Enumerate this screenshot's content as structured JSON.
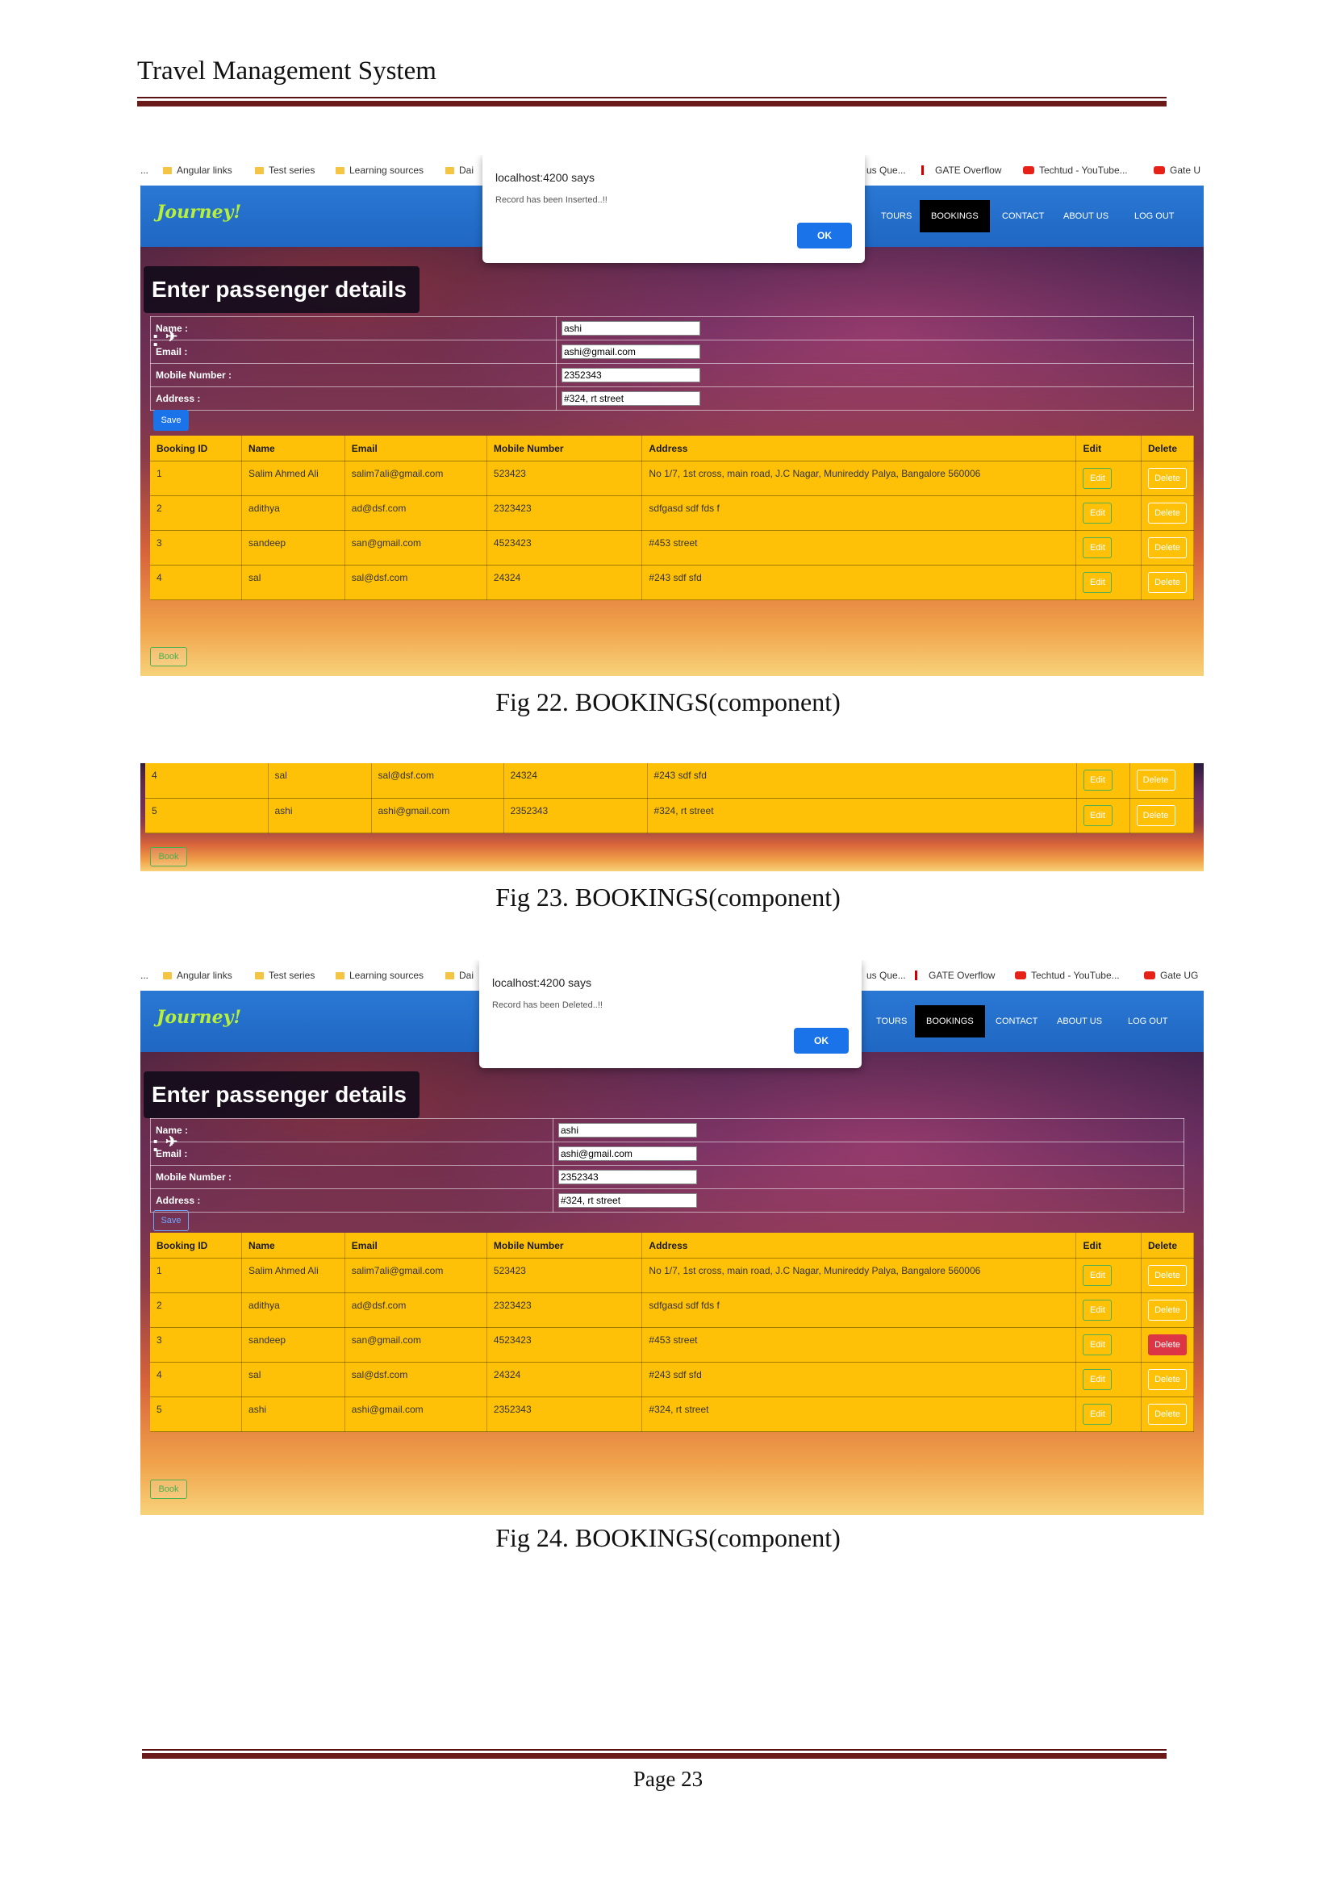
{
  "document": {
    "header_title": "Travel Management System",
    "page_label": "Page 23"
  },
  "bookmarks": {
    "ellipsis": "...",
    "angular": "Angular links",
    "test_series": "Test series",
    "learning": "Learning sources",
    "dai": "Dai",
    "us_que": "us Que...",
    "gate_overflow": "GATE Overflow",
    "techtud": "Techtud - YouTube...",
    "gate_u": "Gate U",
    "gate_ug": "Gate UG"
  },
  "app": {
    "logo": "Journey!",
    "nav": [
      "TOURS",
      "BOOKINGS",
      "CONTACT",
      "ABOUT US",
      "LOG OUT"
    ],
    "heading": "Enter passenger details :",
    "heading_icon": "takeoff-icon",
    "form_labels": [
      "Name :",
      "Email :",
      "Mobile Number :",
      "Address :"
    ],
    "form_values": [
      "ashi",
      "ashi@gmail.com",
      "2352343",
      "#324, rt street"
    ],
    "save_label": "Save",
    "book_label": "Book",
    "edit_label": "Edit",
    "delete_label": "Delete",
    "columns": [
      "Booking ID",
      "Name",
      "Email",
      "Mobile Number",
      "Address",
      "Edit",
      "Delete"
    ],
    "rows": [
      {
        "id": "1",
        "name": "Salim Ahmed Ali",
        "email": "salim7ali@gmail.com",
        "mobile": "523423",
        "address": "No 1/7, 1st cross, main road, J.C Nagar, Munireddy Palya, Bangalore 560006"
      },
      {
        "id": "2",
        "name": "adithya",
        "email": "ad@dsf.com",
        "mobile": "2323423",
        "address": "sdfgasd sdf fds f"
      },
      {
        "id": "3",
        "name": "sandeep",
        "email": "san@gmail.com",
        "mobile": "4523423",
        "address": "#453 street"
      },
      {
        "id": "4",
        "name": "sal",
        "email": "sal@dsf.com",
        "mobile": "24324",
        "address": "#243 sdf sfd"
      },
      {
        "id": "5",
        "name": "ashi",
        "email": "ashi@gmail.com",
        "mobile": "2352343",
        "address": "#324, rt street"
      }
    ]
  },
  "dialogs": {
    "title": "localhost:4200 says",
    "inserted": "Record has been Inserted..!!",
    "deleted": "Record has been Deleted..!!",
    "ok": "OK"
  },
  "captions": {
    "fig22": "Fig 22. BOOKINGS(component)",
    "fig23": "Fig 23. BOOKINGS(component)",
    "fig24": "Fig 24. BOOKINGS(component)"
  },
  "colors": {
    "navbar": "#2a78d4",
    "table": "#ffc107",
    "delete_active": "#dc3545",
    "ok_button": "#1a73e8"
  }
}
